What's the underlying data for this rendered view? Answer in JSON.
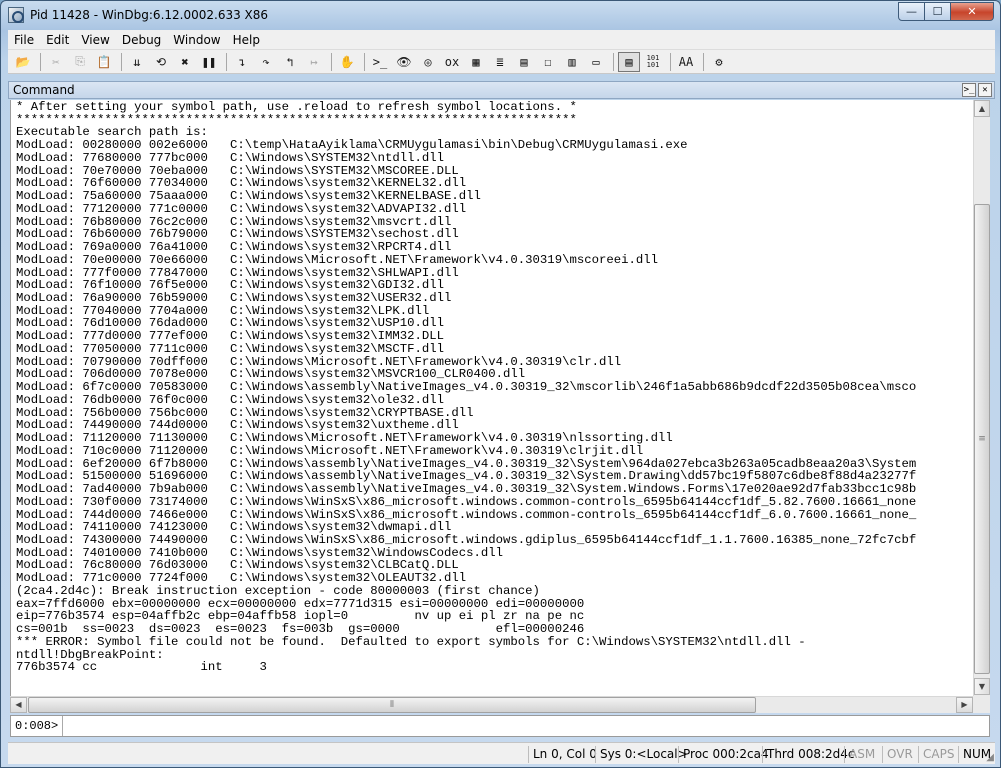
{
  "window": {
    "title": "Pid 11428 - WinDbg:6.12.0002.633 X86",
    "controls": {
      "minimize": "—",
      "maximize": "☐",
      "close": "✕"
    }
  },
  "menu": {
    "items": [
      {
        "id": "file",
        "label": "File"
      },
      {
        "id": "edit",
        "label": "Edit"
      },
      {
        "id": "view",
        "label": "View"
      },
      {
        "id": "debug",
        "label": "Debug"
      },
      {
        "id": "window",
        "label": "Window"
      },
      {
        "id": "help",
        "label": "Help"
      }
    ]
  },
  "toolbar": {
    "open": "📂",
    "cut": "✂",
    "copy": "⎘",
    "paste": "📋",
    "go": "⇊",
    "restart": "⟲",
    "stop": "✖",
    "break": "❚❚",
    "step_into": "↴",
    "step_over": "↷",
    "step_out": "↰",
    "run_to_cursor": "↦",
    "hand": "✋",
    "command": ">_",
    "watch": "👁",
    "locals": "◎",
    "registers": "ox",
    "memory": "▦",
    "call_stack": "≣",
    "disassembly": "▤",
    "scratch": "☐",
    "processes": "▥",
    "source": "▭",
    "source_mode": "▤",
    "hex_mode": "101\n101",
    "font": "AA",
    "options": "⚙"
  },
  "command_pane": {
    "title": "Command",
    "output": "* After setting your symbol path, use .reload to refresh symbol locations. *\n****************************************************************************\nExecutable search path is:\nModLoad: 00280000 002e6000   C:\\temp\\HataAyiklama\\CRMUygulamasi\\bin\\Debug\\CRMUygulamasi.exe\nModLoad: 77680000 777bc000   C:\\Windows\\SYSTEM32\\ntdll.dll\nModLoad: 70e70000 70eba000   C:\\Windows\\SYSTEM32\\MSCOREE.DLL\nModLoad: 76f60000 77034000   C:\\Windows\\system32\\KERNEL32.dll\nModLoad: 75a60000 75aaa000   C:\\Windows\\system32\\KERNELBASE.dll\nModLoad: 77120000 771c0000   C:\\Windows\\system32\\ADVAPI32.dll\nModLoad: 76b80000 76c2c000   C:\\Windows\\system32\\msvcrt.dll\nModLoad: 76b60000 76b79000   C:\\Windows\\SYSTEM32\\sechost.dll\nModLoad: 769a0000 76a41000   C:\\Windows\\system32\\RPCRT4.dll\nModLoad: 70e00000 70e66000   C:\\Windows\\Microsoft.NET\\Framework\\v4.0.30319\\mscoreei.dll\nModLoad: 777f0000 77847000   C:\\Windows\\system32\\SHLWAPI.dll\nModLoad: 76f10000 76f5e000   C:\\Windows\\system32\\GDI32.dll\nModLoad: 76a90000 76b59000   C:\\Windows\\system32\\USER32.dll\nModLoad: 77040000 7704a000   C:\\Windows\\system32\\LPK.dll\nModLoad: 76d10000 76dad000   C:\\Windows\\system32\\USP10.dll\nModLoad: 777d0000 777ef000   C:\\Windows\\system32\\IMM32.DLL\nModLoad: 77050000 7711c000   C:\\Windows\\system32\\MSCTF.dll\nModLoad: 70790000 70dff000   C:\\Windows\\Microsoft.NET\\Framework\\v4.0.30319\\clr.dll\nModLoad: 706d0000 7078e000   C:\\Windows\\system32\\MSVCR100_CLR0400.dll\nModLoad: 6f7c0000 70583000   C:\\Windows\\assembly\\NativeImages_v4.0.30319_32\\mscorlib\\246f1a5abb686b9dcdf22d3505b08cea\\msco\nModLoad: 76db0000 76f0c000   C:\\Windows\\system32\\ole32.dll\nModLoad: 756b0000 756bc000   C:\\Windows\\system32\\CRYPTBASE.dll\nModLoad: 74490000 744d0000   C:\\Windows\\system32\\uxtheme.dll\nModLoad: 71120000 71130000   C:\\Windows\\Microsoft.NET\\Framework\\v4.0.30319\\nlssorting.dll\nModLoad: 710c0000 71120000   C:\\Windows\\Microsoft.NET\\Framework\\v4.0.30319\\clrjit.dll\nModLoad: 6ef20000 6f7b8000   C:\\Windows\\assembly\\NativeImages_v4.0.30319_32\\System\\964da027ebca3b263a05cadb8eaa20a3\\System\nModLoad: 51500000 51696000   C:\\Windows\\assembly\\NativeImages_v4.0.30319_32\\System.Drawing\\dd57bc19f5807c6dbe8f88d4a23277f\nModLoad: 7ad40000 7b9ab000   C:\\Windows\\assembly\\NativeImages_v4.0.30319_32\\System.Windows.Forms\\17e020ae92d7fab33bcc1c98b\nModLoad: 730f0000 73174000   C:\\Windows\\WinSxS\\x86_microsoft.windows.common-controls_6595b64144ccf1df_5.82.7600.16661_none\nModLoad: 744d0000 7466e000   C:\\Windows\\WinSxS\\x86_microsoft.windows.common-controls_6595b64144ccf1df_6.0.7600.16661_none_\nModLoad: 74110000 74123000   C:\\Windows\\system32\\dwmapi.dll\nModLoad: 74300000 74490000   C:\\Windows\\WinSxS\\x86_microsoft.windows.gdiplus_6595b64144ccf1df_1.1.7600.16385_none_72fc7cbf\nModLoad: 74010000 7410b000   C:\\Windows\\system32\\WindowsCodecs.dll\nModLoad: 76c80000 76d03000   C:\\Windows\\system32\\CLBCatQ.DLL\nModLoad: 771c0000 7724f000   C:\\Windows\\system32\\OLEAUT32.dll\n(2ca4.2d4c): Break instruction exception - code 80000003 (first chance)\neax=7ffd6000 ebx=00000000 ecx=00000000 edx=7771d315 esi=00000000 edi=00000000\neip=776b3574 esp=04affb2c ebp=04affb58 iopl=0         nv up ei pl zr na pe nc\ncs=001b  ss=0023  ds=0023  es=0023  fs=003b  gs=0000             efl=00000246\n*** ERROR: Symbol file could not be found.  Defaulted to export symbols for C:\\Windows\\SYSTEM32\\ntdll.dll -\nntdll!DbgBreakPoint:\n776b3574 cc              int     3",
    "prompt": "0:008>",
    "input_value": ""
  },
  "statusbar": {
    "line_col": "Ln 0, Col 0",
    "sys": "Sys 0:<Local>",
    "proc": "Proc 000:2ca4",
    "thrd": "Thrd 008:2d4c",
    "asm": "ASM",
    "ovr": "OVR",
    "caps": "CAPS",
    "num": "NUM"
  }
}
